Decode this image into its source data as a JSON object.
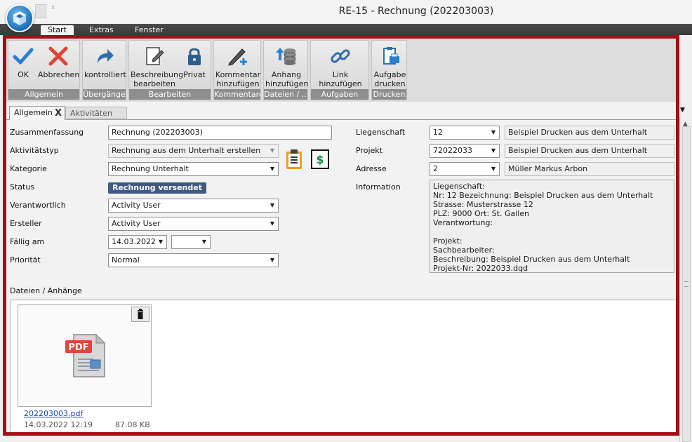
{
  "window": {
    "title": "RE-15 - Rechnung (202203003)",
    "qa_dropdown": "⩡"
  },
  "ribbon_tabs": [
    "Start",
    "Extras",
    "Fenster"
  ],
  "ribbon": {
    "groups": [
      {
        "label": "Allgemein",
        "buttons": [
          "OK",
          "Abbrechen"
        ]
      },
      {
        "label": "Übergänge",
        "buttons": [
          "kontrolliert"
        ]
      },
      {
        "label": "Bearbeiten",
        "buttons": [
          "Beschreibung\nbearbeiten",
          "Privat"
        ]
      },
      {
        "label": "Kommentare",
        "buttons": [
          "Kommentar\nhinzufügen"
        ]
      },
      {
        "label": "Dateien / ...",
        "buttons": [
          "Anhang\nhinzufügen"
        ]
      },
      {
        "label": "Aufgaben",
        "buttons": [
          "Link hinzufügen"
        ]
      },
      {
        "label": "Drucken",
        "buttons": [
          "Aufgabe\ndrucken"
        ]
      }
    ]
  },
  "doc_tabs": [
    {
      "label": "Allgemein",
      "close": "X"
    },
    {
      "label": "Aktivitäten"
    }
  ],
  "form": {
    "zusammenfassung": {
      "label": "Zusammenfassung",
      "value": "Rechnung (202203003)"
    },
    "aktivitaetstyp": {
      "label": "Aktivitätstyp",
      "value": "Rechnung aus dem Unterhalt erstellen"
    },
    "kategorie": {
      "label": "Kategorie",
      "value": "Rechnung Unterhalt"
    },
    "status": {
      "label": "Status",
      "value": "Rechnung versendet"
    },
    "verantwortlich": {
      "label": "Verantwortlich",
      "value": "Activity User"
    },
    "ersteller": {
      "label": "Ersteller",
      "value": "Activity User"
    },
    "faellig": {
      "label": "Fällig am",
      "date": "14.03.2022",
      "time": ""
    },
    "prioritaet": {
      "label": "Priorität",
      "value": "Normal"
    }
  },
  "right": {
    "liegenschaft": {
      "label": "Liegenschaft",
      "value": "12",
      "desc": "Beispiel Drucken aus dem Unterhalt"
    },
    "projekt": {
      "label": "Projekt",
      "value": "72022033",
      "desc": "Beispiel Drucken aus dem Unterhalt"
    },
    "adresse": {
      "label": "Adresse",
      "value": "2",
      "desc": "Müller Markus Arbon"
    },
    "information": {
      "label": "Information",
      "lines": [
        "Liegenschaft:",
        "Nr: 12 Bezeichnung: Beispiel Drucken aus dem Unterhalt",
        "Strasse: Musterstrasse 12",
        "PLZ: 9000 Ort: St. Gallen",
        "Verantwortung:",
        "",
        "Projekt:",
        "Sachbearbeiter:",
        "Beschreibung: Beispiel Drucken aus dem Unterhalt",
        "Projekt-Nr: 2022033.dqd"
      ]
    }
  },
  "attachments": {
    "label": "Dateien / Anhänge",
    "items": [
      {
        "filename": "202203003.pdf",
        "date": "14.03.2022 12:19",
        "size": "87.08 KB",
        "icon_text": "PDF"
      }
    ]
  },
  "colors": {
    "frame": "#a10e16",
    "status_badge": "#3f5a80",
    "ok": "#2a7fd0",
    "cancel": "#e04236"
  }
}
